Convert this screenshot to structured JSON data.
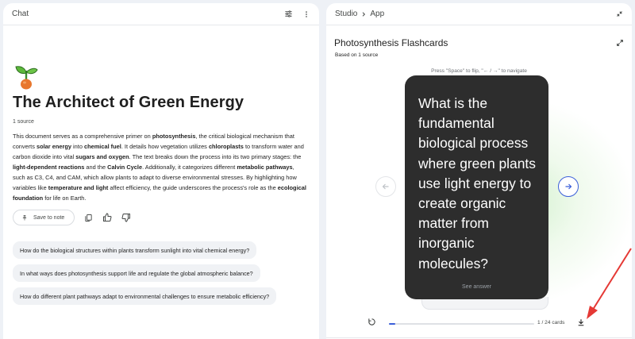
{
  "chat": {
    "header_title": "Chat",
    "doc_title": "The Architect of Green Energy",
    "source_count": "1 source",
    "summary_parts": [
      {
        "t": "This document serves as a comprehensive primer on ",
        "b": false
      },
      {
        "t": "photosynthesis",
        "b": true
      },
      {
        "t": ", the critical biological mechanism that converts ",
        "b": false
      },
      {
        "t": "solar energy",
        "b": true
      },
      {
        "t": " into ",
        "b": false
      },
      {
        "t": "chemical fuel",
        "b": true
      },
      {
        "t": ". It details how vegetation utilizes ",
        "b": false
      },
      {
        "t": "chloroplasts",
        "b": true
      },
      {
        "t": " to transform water and carbon dioxide into vital ",
        "b": false
      },
      {
        "t": "sugars and oxygen",
        "b": true
      },
      {
        "t": ". The text breaks down the process into its two primary stages: the ",
        "b": false
      },
      {
        "t": "light-dependent reactions",
        "b": true
      },
      {
        "t": " and the ",
        "b": false
      },
      {
        "t": "Calvin Cycle",
        "b": true
      },
      {
        "t": ". Additionally, it categorizes different ",
        "b": false
      },
      {
        "t": "metabolic pathways",
        "b": true
      },
      {
        "t": ", such as C3, C4, and CAM, which allow plants to adapt to diverse environmental stresses. By highlighting how variables like ",
        "b": false
      },
      {
        "t": "temperature and light",
        "b": true
      },
      {
        "t": " affect efficiency, the guide underscores the process's role as the ",
        "b": false
      },
      {
        "t": "ecological foundation",
        "b": true
      },
      {
        "t": " for life on Earth.",
        "b": false
      }
    ],
    "save_label": "Save to note",
    "suggestions": [
      "How do the biological structures within plants transform sunlight into vital chemical energy?",
      "In what ways does photosynthesis support life and regulate the global atmospheric balance?",
      "How do different plant pathways adapt to environmental challenges to ensure metabolic efficiency?"
    ]
  },
  "studio": {
    "breadcrumb_root": "Studio",
    "breadcrumb_leaf": "App",
    "flashcards_title": "Photosynthesis Flashcards",
    "based_on": "Based on 1 source",
    "hint": "Press \"Space\" to flip, \"← / →\" to navigate",
    "card_question": "What is the fundamental biological process where green plants use light energy to create organic matter from inorganic molecules?",
    "see_answer": "See answer",
    "card_count": "1 / 24 cards",
    "progress": 0.042
  },
  "colors": {
    "accent": "#3b5fd9",
    "card_bg": "#2d2d2d",
    "annotation_arrow": "#e53935"
  }
}
